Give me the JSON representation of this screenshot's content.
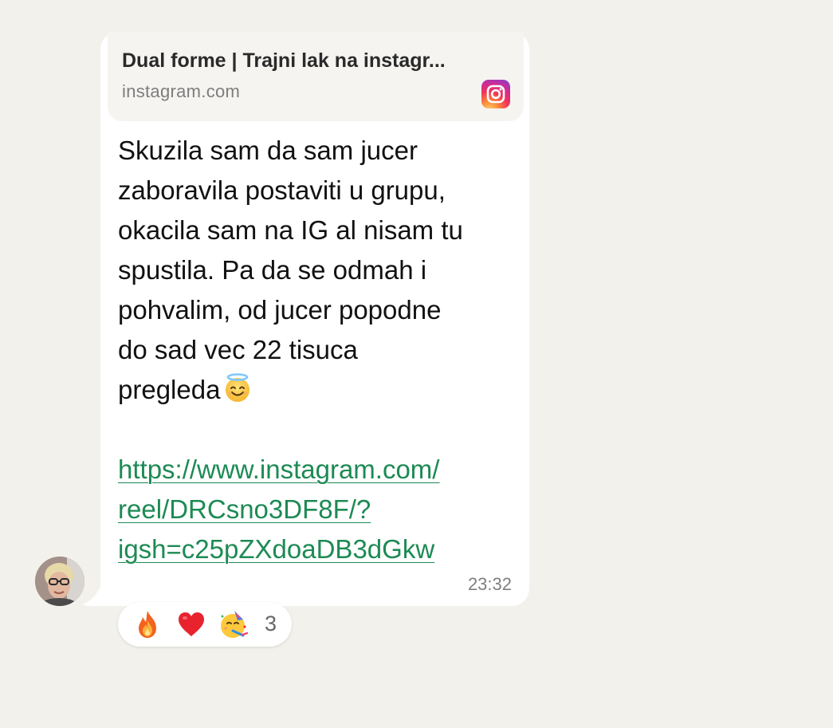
{
  "link_preview": {
    "title": "Dual forme | Trajni lak na instagr...",
    "domain": "instagram.com",
    "icon": "instagram-icon"
  },
  "message": {
    "lines": [
      "Skuzila sam da sam jucer",
      "zaboravila postaviti u grupu,",
      "okacila sam na IG al nisam tu",
      "spustila. Pa da se odmah i",
      "pohvalim, od jucer popodne",
      "do sad vec 22 tisuca",
      "pregleda"
    ],
    "emoji": "smiling-face-with-halo",
    "link_lines": [
      "https://www.instagram.com/",
      "reel/DRCsno3DF8F/?",
      "igsh=c25pZXdoaDB3dGkw"
    ],
    "time": "23:32"
  },
  "reactions": {
    "emojis": [
      "fire",
      "red-heart",
      "partying-face"
    ],
    "count": "3"
  },
  "colors": {
    "background": "#f3f1ec",
    "bubble": "#ffffff",
    "link": "#1d8a54",
    "preview_bg": "#f5f4f1",
    "timestamp": "#7f7f7f"
  }
}
